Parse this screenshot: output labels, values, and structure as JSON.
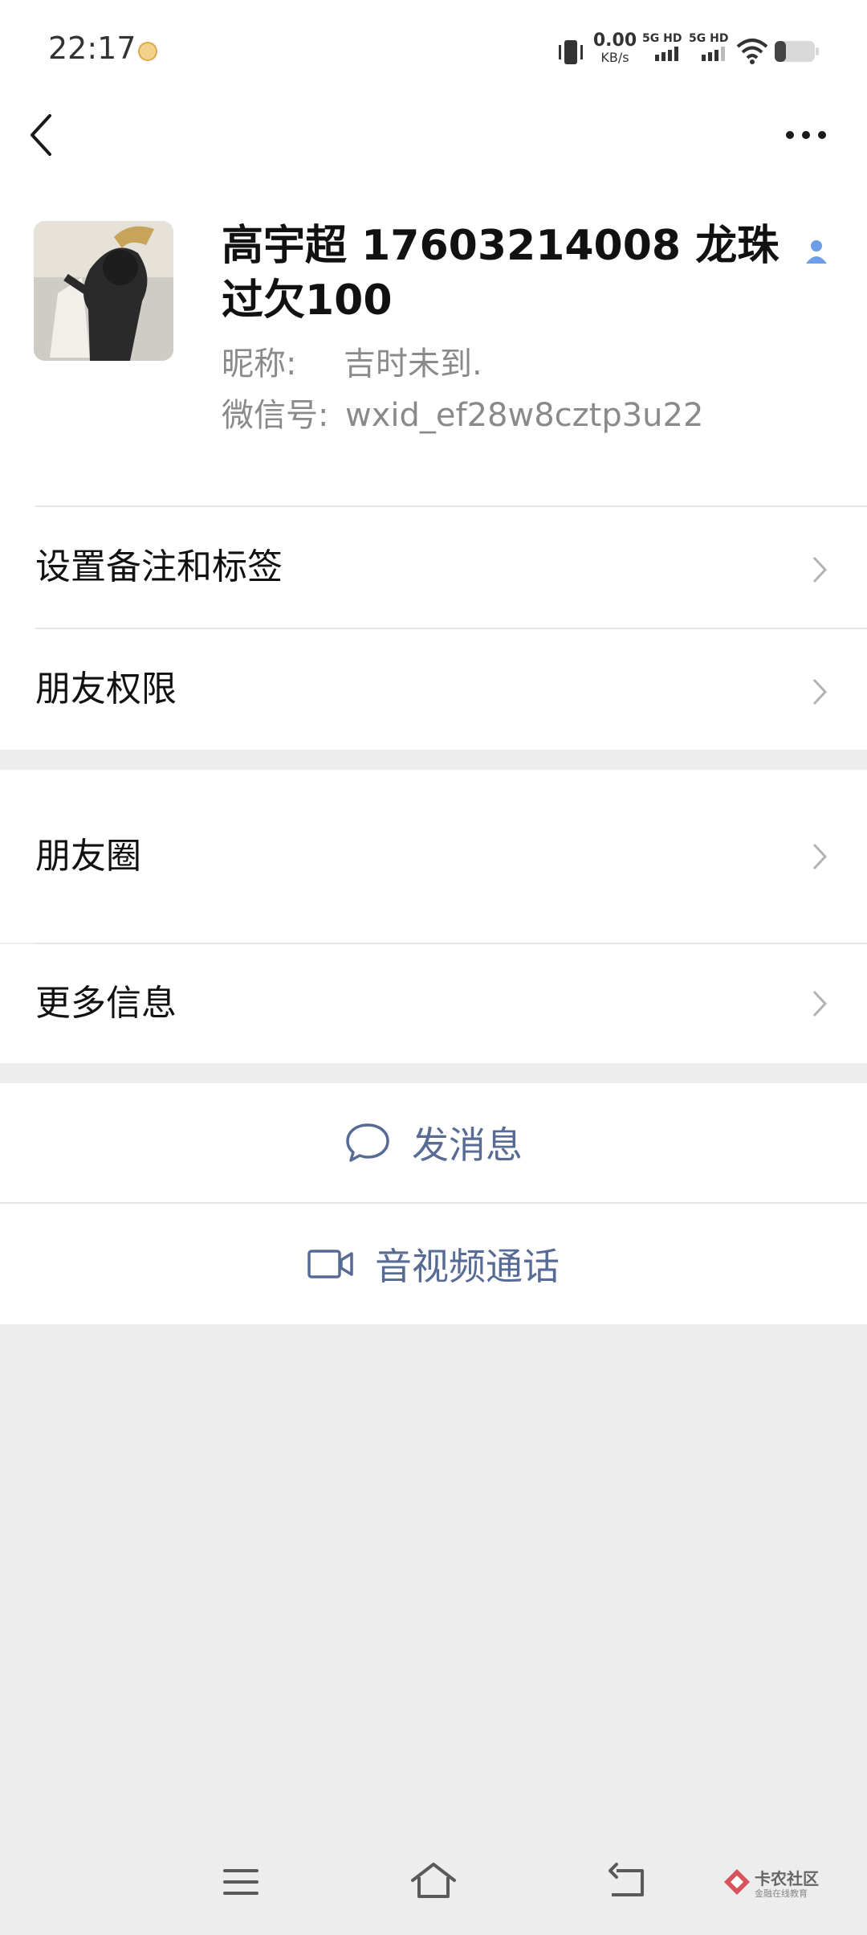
{
  "status_bar": {
    "time": "22:17",
    "net_speed_value": "0.00",
    "net_speed_unit": "KB/s",
    "sim1_label": "5G HD",
    "sim2_label": "5G HD"
  },
  "profile": {
    "display_name": "高宇超 17603214008 龙珠过欠100",
    "nickname_label": "昵称:",
    "nickname_value": "吉时未到.",
    "wechat_id_label": "微信号:",
    "wechat_id_value": "wxid_ef28w8cztp3u22"
  },
  "rows": {
    "remark_tags": "设置备注和标签",
    "friend_permissions": "朋友权限",
    "moments": "朋友圈",
    "more_info": "更多信息"
  },
  "actions": {
    "send_message": "发消息",
    "av_call": "音视频通话"
  },
  "watermark": {
    "title": "卡农社区",
    "subtitle": "金融在线教育"
  },
  "colors": {
    "accent_link": "#576b95",
    "page_bg": "#ededed",
    "contact_icon": "#6b9de8"
  }
}
